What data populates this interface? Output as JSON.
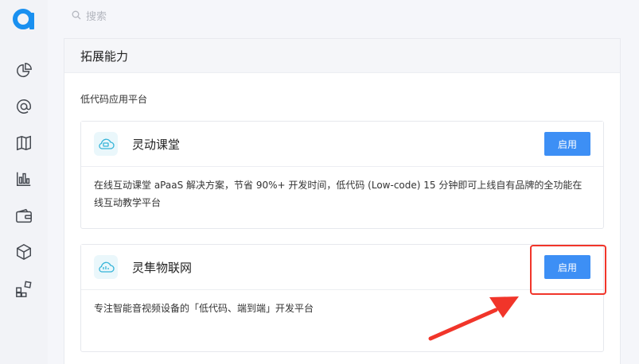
{
  "sidebar": {
    "logo": "brand-logo",
    "items": [
      {
        "icon": "dashboard-pie-icon"
      },
      {
        "icon": "at-sign-icon"
      },
      {
        "icon": "map-icon"
      },
      {
        "icon": "bar-chart-icon"
      },
      {
        "icon": "wallet-icon"
      },
      {
        "icon": "cube-icon"
      },
      {
        "icon": "apps-grid-icon"
      }
    ]
  },
  "search": {
    "placeholder": "搜索"
  },
  "panel": {
    "title": "拓展能力",
    "section_label": "低代码应用平台",
    "cards": [
      {
        "title": "灵动课堂",
        "button": "启用",
        "description": "在线互动课堂 aPaaS 解决方案，节省 90%+ 开发时间，低代码 (Low-code) 15 分钟即可上线自有品牌的全功能在线互动教学平台",
        "icon": "cloud-classroom-icon"
      },
      {
        "title": "灵隼物联网",
        "button": "启用",
        "description": "专注智能音视频设备的「低代码、端到端」开发平台",
        "icon": "cloud-iot-icon"
      }
    ]
  },
  "colors": {
    "accent": "#3d8ff5",
    "highlight": "#f1352a"
  }
}
